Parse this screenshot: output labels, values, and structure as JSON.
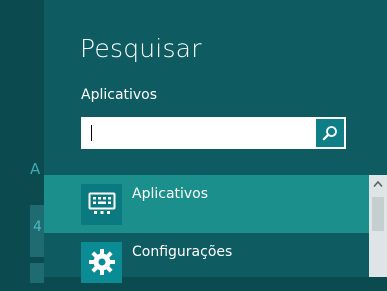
{
  "backdrop": {
    "partial_letter": "A",
    "tile_glyph": "4"
  },
  "charm": {
    "title": "Pesquisar",
    "scope_label": "Aplicativos",
    "search": {
      "value": "",
      "placeholder": ""
    }
  },
  "results": [
    {
      "label": "Aplicativos",
      "icon": "keyboard-icon",
      "selected": true
    },
    {
      "label": "Configurações",
      "icon": "gear-icon",
      "selected": false
    }
  ],
  "colors": {
    "pane": "#0e5b61",
    "selected_row": "#1a8f8b",
    "icon_tile": "#0b8c94",
    "search_button": "#0e7f86"
  }
}
